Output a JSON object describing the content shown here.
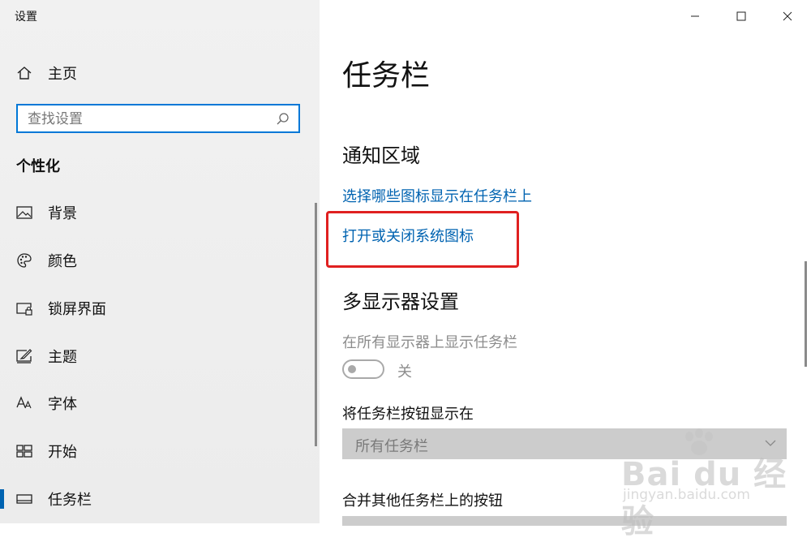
{
  "window": {
    "title": "设置"
  },
  "sidebar": {
    "home_label": "主页",
    "search_placeholder": "查找设置",
    "section_title": "个性化",
    "items": [
      {
        "label": "背景",
        "icon": "image-icon"
      },
      {
        "label": "颜色",
        "icon": "palette-icon"
      },
      {
        "label": "锁屏界面",
        "icon": "lock-screen-icon"
      },
      {
        "label": "主题",
        "icon": "theme-icon"
      },
      {
        "label": "字体",
        "icon": "font-icon"
      },
      {
        "label": "开始",
        "icon": "start-icon"
      },
      {
        "label": "任务栏",
        "icon": "taskbar-icon",
        "active": true
      }
    ]
  },
  "main": {
    "page_title": "任务栏",
    "notification_area": {
      "heading": "通知区域",
      "link_select_icons": "选择哪些图标显示在任务栏上",
      "link_system_icons": "打开或关闭系统图标"
    },
    "multi_display": {
      "heading": "多显示器设置",
      "show_taskbar_label": "在所有显示器上显示任务栏",
      "toggle_state": "关",
      "buttons_on_label": "将任务栏按钮显示在",
      "buttons_on_value": "所有任务栏",
      "combine_label": "合并其他任务栏上的按钮"
    }
  },
  "watermark": {
    "brand": "Bai du 经验",
    "url": "jingyan.baidu.com"
  },
  "colors": {
    "accent": "#0078d7",
    "link": "#0063b1",
    "highlight": "#e02020"
  }
}
